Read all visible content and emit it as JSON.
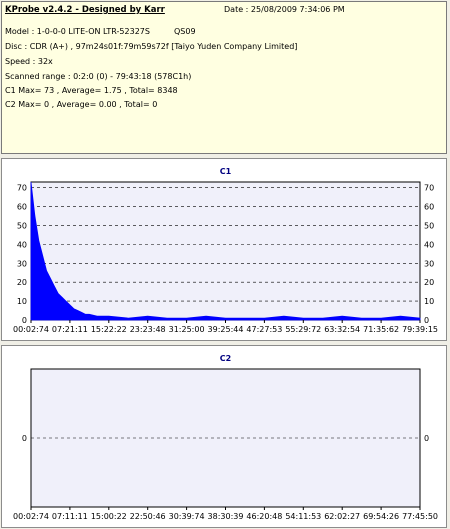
{
  "header": {
    "title": "KProbe v2.4.2 - Designed by Karr",
    "date": "Date : 25/08/2009 7:34:06 PM",
    "model": "Model : 1-0-0-0 LITE-ON LTR-52327S",
    "firmware": "QS09",
    "disc": "Disc : CDR (A+) , 97m24s01f:79m59s72f [Taiyo Yuden Company Limited]",
    "speed": "Speed : 32x",
    "scanned_range": "Scanned range : 0:2:0 (0) - 79:43:18 (578C1h)",
    "c1_summary": "C1 Max= 73 , Average= 1.75 , Total= 8348",
    "c2_summary": "C2 Max= 0 , Average= 0.00 , Total= 0"
  },
  "colors": {
    "bar": "#0000ff",
    "plot_bg": "#f0f0fa",
    "grid": "#000000",
    "title": "#000080"
  },
  "chart_data": [
    {
      "type": "area",
      "title": "C1",
      "ylim": [
        0,
        73
      ],
      "yticks": [
        "0",
        "10",
        "20",
        "30",
        "40",
        "50",
        "60",
        "70"
      ],
      "xticks": [
        "00:02:74",
        "07:21:11",
        "15:22:22",
        "23:23:48",
        "31:25:00",
        "39:25:44",
        "47:27:53",
        "55:29:72",
        "63:32:54",
        "71:35:62",
        "79:39:15"
      ],
      "x": [
        0,
        0.01,
        0.02,
        0.03,
        0.04,
        0.05,
        0.06,
        0.07,
        0.08,
        0.09,
        0.1,
        0.11,
        0.12,
        0.13,
        0.14,
        0.15,
        0.17,
        0.2,
        0.25,
        0.3,
        0.35,
        0.4,
        0.45,
        0.5,
        0.55,
        0.6,
        0.65,
        0.7,
        0.75,
        0.8,
        0.85,
        0.9,
        0.95,
        1.0
      ],
      "values": [
        73,
        55,
        42,
        34,
        26,
        22,
        18,
        14,
        12,
        10,
        8,
        6,
        5,
        4,
        3,
        3,
        2,
        2,
        1,
        2,
        1,
        1,
        2,
        1,
        1,
        1,
        2,
        1,
        1,
        2,
        1,
        1,
        2,
        1
      ]
    },
    {
      "type": "area",
      "title": "C2",
      "ylim": [
        -1,
        1
      ],
      "yticks": [
        "0"
      ],
      "xticks": [
        "00:02:74",
        "07:11:11",
        "15:00:22",
        "22:50:46",
        "30:39:74",
        "38:30:39",
        "46:20:48",
        "54:11:53",
        "62:02:27",
        "69:54:26",
        "77:45:50"
      ],
      "values": [
        0
      ]
    }
  ]
}
